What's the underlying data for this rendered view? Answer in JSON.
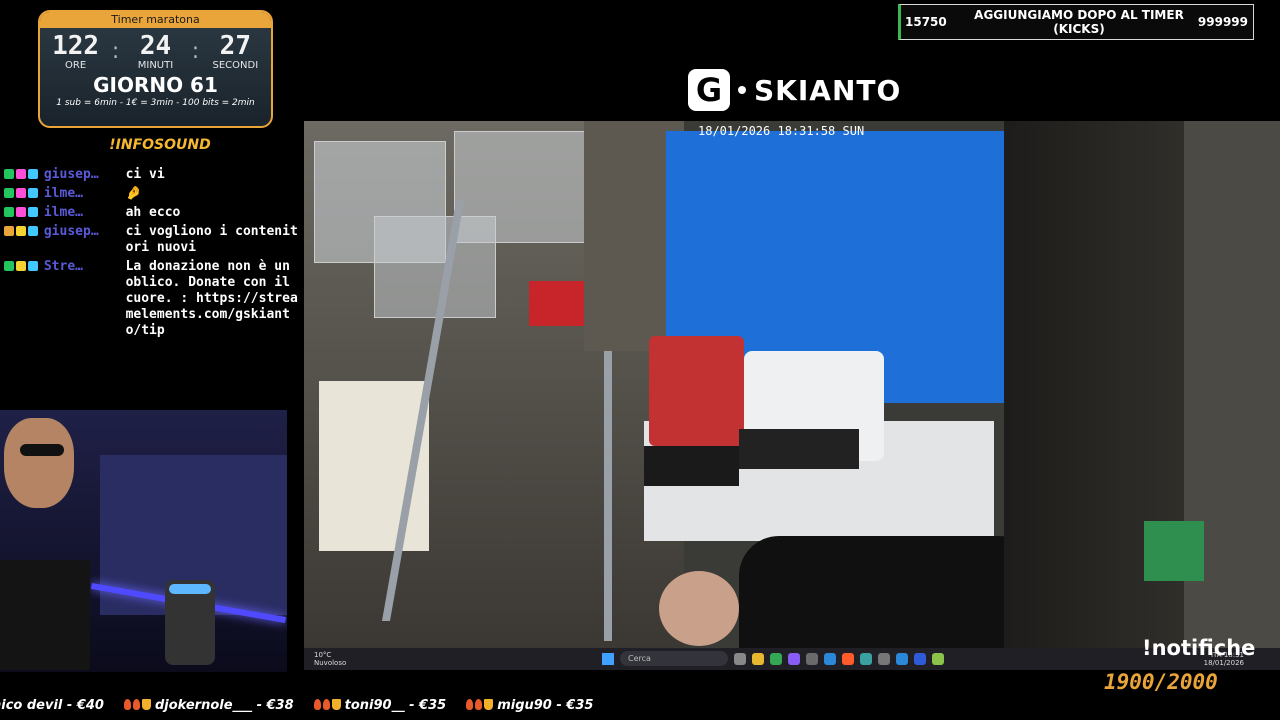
{
  "timer": {
    "title": "Timer maratona",
    "hours": "122",
    "hours_label": "ORE",
    "minutes": "24",
    "minutes_label": "MINUTI",
    "seconds": "27",
    "seconds_label": "SECONDI",
    "day": "GIORNO 61",
    "rules": "1 sub = 6min - 1€ = 3min - 100 bits = 2min"
  },
  "infosound": "!INFOSOUND",
  "chat": [
    {
      "user": "giusep…",
      "text": "ci vi",
      "badges": [
        "#22c55e",
        "#ff4fd8",
        "#40c8ff"
      ]
    },
    {
      "user": "ilme…",
      "text": "🤌",
      "badges": [
        "#22c55e",
        "#ff4fd8",
        "#40c8ff"
      ]
    },
    {
      "user": "ilme…",
      "text": "ah ecco",
      "badges": [
        "#22c55e",
        "#ff4fd8",
        "#40c8ff"
      ]
    },
    {
      "user": "giusep…",
      "text": "ci vogliono i contenitori nuovi",
      "badges": [
        "#e9a53a",
        "#f5d330",
        "#40c8ff"
      ]
    },
    {
      "user": "Stre…",
      "text": "La donazione non è un oblico. Donate con il cuore. : https://streamelements.com/gskianto/tip",
      "badges": [
        "#22c55e",
        "#f5d330",
        "#40c8ff"
      ]
    }
  ],
  "topbox": {
    "left": "15750",
    "center": "AGGIUNGIAMO DOPO AL TIMER (KICKS)",
    "right": "999999"
  },
  "logo": {
    "letter": "G",
    "name": "SKIANTO"
  },
  "camera": {
    "timestamp": "18/01/2026 18:31:58 SUN"
  },
  "taskbar": {
    "weather_temp": "10°C",
    "weather_desc": "Nuvoloso",
    "search": "Cerca",
    "lang": "ITA",
    "time": "18:31",
    "date": "18/01/2026",
    "app_colors": [
      "#888",
      "#e8b830",
      "#35a853",
      "#8a5cf6",
      "#6a6a6a",
      "#2b88d8",
      "#ff5a2a",
      "#3aa0a0",
      "#777",
      "#2b88d8",
      "#2e5bd8",
      "#8bc34a"
    ]
  },
  "notifiche": "!notifiche",
  "goal": "1900/2000",
  "ticker": [
    {
      "name": "nico devil",
      "amount": "€40"
    },
    {
      "name": "djokernole___",
      "amount": "€38"
    },
    {
      "name": "toni90__",
      "amount": "€35"
    },
    {
      "name": "migu90",
      "amount": "€35"
    }
  ]
}
